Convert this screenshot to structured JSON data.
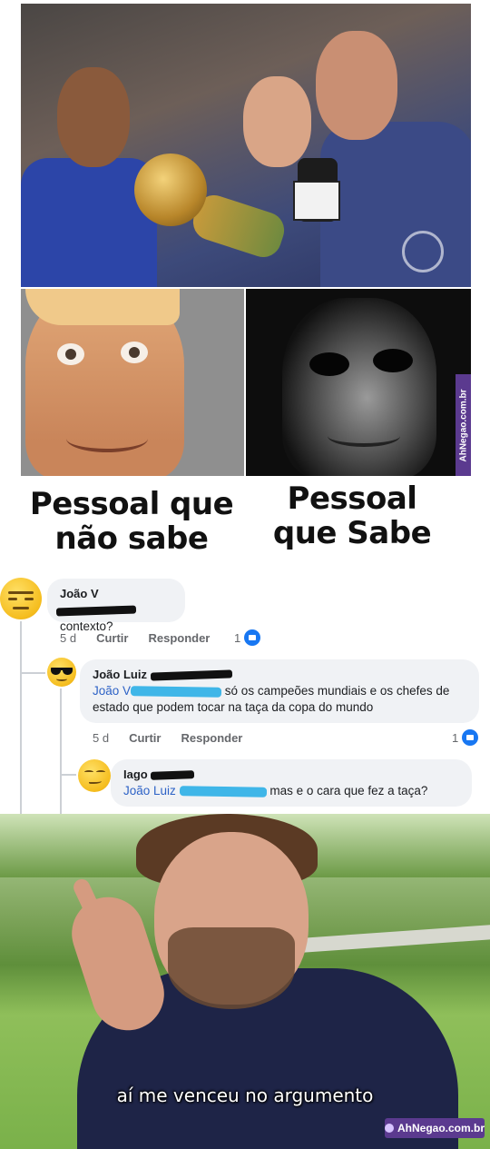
{
  "meme_top": {
    "caption_left": "Pessoal que não sabe",
    "caption_right": "Pessoal que Sabe",
    "watermark": "AhNegao.com.br"
  },
  "comments": [
    {
      "author": "João V",
      "text": "contexto?",
      "time": "5 d",
      "like_label": "Curtir",
      "reply_label": "Responder",
      "likes": "1"
    },
    {
      "author": "João Luiz",
      "mention": "João V",
      "text": "só os campeões mundiais e os chefes de estado que podem tocar na taça da copa do mundo",
      "time": "5 d",
      "like_label": "Curtir",
      "reply_label": "Responder",
      "likes": "1"
    },
    {
      "author": "Iago",
      "mention": "João Luiz",
      "text": "mas e o cara que fez a taça?"
    }
  ],
  "meme_bottom": {
    "subtitle": "aí me venceu no argumento",
    "watermark": "AhNegao.com.br"
  }
}
